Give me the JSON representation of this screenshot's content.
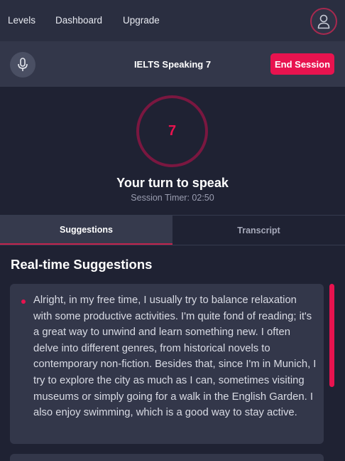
{
  "nav": {
    "levels": "Levels",
    "dashboard": "Dashboard",
    "upgrade": "Upgrade",
    "avatar_icon": "user-icon"
  },
  "session": {
    "mic_icon": "microphone-icon",
    "title": "IELTS Speaking 7",
    "end_label": "End Session"
  },
  "timer": {
    "count": "7",
    "turn_text": "Your turn to speak",
    "session_timer": "Session Timer: 02:50"
  },
  "tabs": [
    {
      "label": "Suggestions",
      "active": true
    },
    {
      "label": "Transcript",
      "active": false
    }
  ],
  "suggestions": {
    "title": "Real-time Suggestions",
    "items": [
      "Alright, in my free time, I usually try to balance relaxation with some productive activities. I'm quite fond of reading; it's a great way to unwind and learn something new. I often delve into different genres, from historical novels to contemporary non-fiction. Besides that, since I'm in Munich, I try to explore the city as much as I can, sometimes visiting museums or simply going for a walk in the English Garden. I also enjoy swimming, which is a good way to stay active."
    ]
  },
  "colors": {
    "accent": "#e8134f",
    "background": "#1f2233",
    "panel": "#33374a"
  }
}
